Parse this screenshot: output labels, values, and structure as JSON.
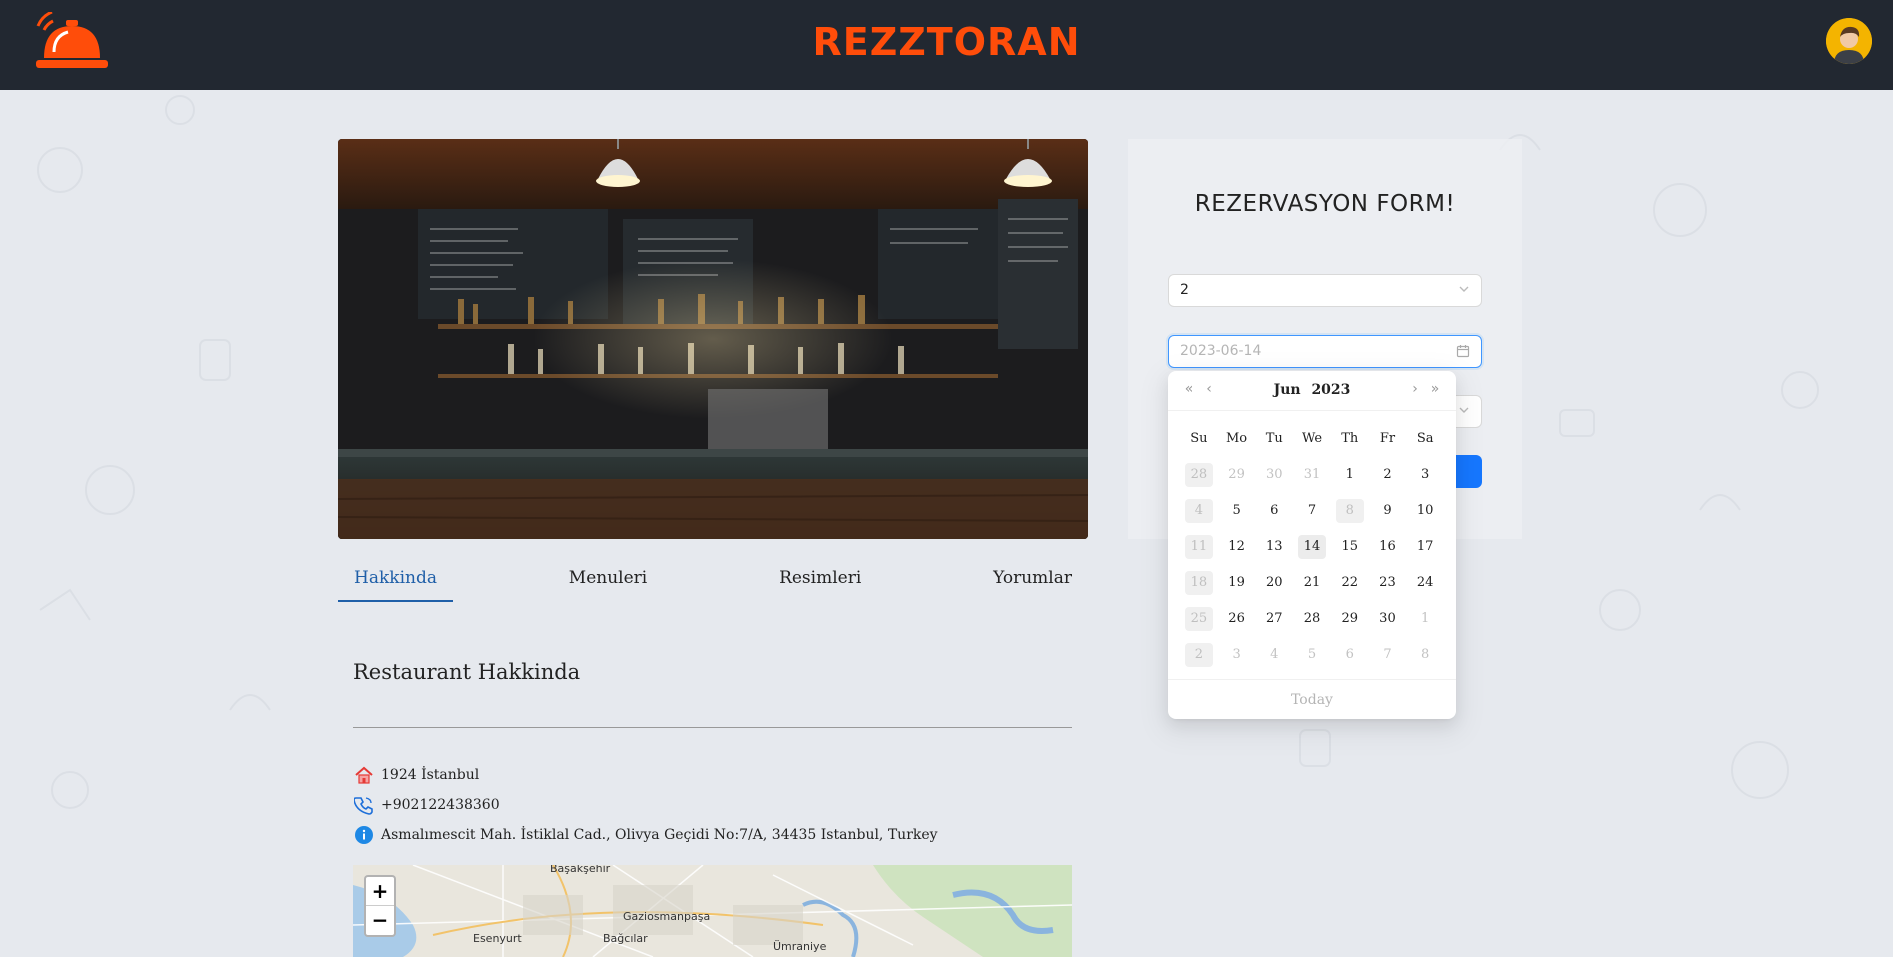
{
  "header": {
    "brand": "REZZTORAN",
    "accent_color": "#ff4d0a",
    "logo_icon": "service-bell-icon",
    "avatar_icon": "user-avatar-icon"
  },
  "tabs": [
    {
      "label": "Hakkinda",
      "active": true
    },
    {
      "label": "Menuleri",
      "active": false
    },
    {
      "label": "Resimleri",
      "active": false
    },
    {
      "label": "Yorumlar",
      "active": false
    }
  ],
  "about": {
    "title": "Restaurant Hakkinda",
    "name": "1924 İstanbul",
    "phone": "+902122438360",
    "address": "Asmalımescit Mah. İstiklal Cad., Olivya Geçidi No:7/A, 34435 Istanbul, Turkey"
  },
  "map": {
    "zoom_in": "+",
    "zoom_out": "−",
    "labels": [
      "Başakşehir",
      "Gaziosmanpaşa",
      "Esenyurt",
      "Bağcılar",
      "Ümraniye"
    ]
  },
  "reservation": {
    "title": "REZERVASYON FORM!",
    "guests_value": "2",
    "date_placeholder": "2023-06-14",
    "button_color": "#1677ff"
  },
  "calendar": {
    "month": "Jun",
    "year": "2023",
    "weekdays": [
      "Su",
      "Mo",
      "Tu",
      "We",
      "Th",
      "Fr",
      "Sa"
    ],
    "weeks": [
      [
        {
          "d": "28",
          "s": "disabled"
        },
        {
          "d": "29",
          "s": "other"
        },
        {
          "d": "30",
          "s": "other"
        },
        {
          "d": "31",
          "s": "other"
        },
        {
          "d": "1",
          "s": ""
        },
        {
          "d": "2",
          "s": ""
        },
        {
          "d": "3",
          "s": ""
        }
      ],
      [
        {
          "d": "4",
          "s": "disabled"
        },
        {
          "d": "5",
          "s": ""
        },
        {
          "d": "6",
          "s": ""
        },
        {
          "d": "7",
          "s": ""
        },
        {
          "d": "8",
          "s": "disabled"
        },
        {
          "d": "9",
          "s": ""
        },
        {
          "d": "10",
          "s": ""
        }
      ],
      [
        {
          "d": "11",
          "s": "disabled"
        },
        {
          "d": "12",
          "s": ""
        },
        {
          "d": "13",
          "s": ""
        },
        {
          "d": "14",
          "s": "today"
        },
        {
          "d": "15",
          "s": ""
        },
        {
          "d": "16",
          "s": ""
        },
        {
          "d": "17",
          "s": ""
        }
      ],
      [
        {
          "d": "18",
          "s": "disabled"
        },
        {
          "d": "19",
          "s": ""
        },
        {
          "d": "20",
          "s": ""
        },
        {
          "d": "21",
          "s": ""
        },
        {
          "d": "22",
          "s": ""
        },
        {
          "d": "23",
          "s": ""
        },
        {
          "d": "24",
          "s": ""
        }
      ],
      [
        {
          "d": "25",
          "s": "disabled"
        },
        {
          "d": "26",
          "s": ""
        },
        {
          "d": "27",
          "s": ""
        },
        {
          "d": "28",
          "s": ""
        },
        {
          "d": "29",
          "s": ""
        },
        {
          "d": "30",
          "s": ""
        },
        {
          "d": "1",
          "s": "other"
        }
      ],
      [
        {
          "d": "2",
          "s": "disabled"
        },
        {
          "d": "3",
          "s": "other"
        },
        {
          "d": "4",
          "s": "other"
        },
        {
          "d": "5",
          "s": "other"
        },
        {
          "d": "6",
          "s": "other"
        },
        {
          "d": "7",
          "s": "other"
        },
        {
          "d": "8",
          "s": "other"
        }
      ]
    ],
    "today_label": "Today"
  }
}
